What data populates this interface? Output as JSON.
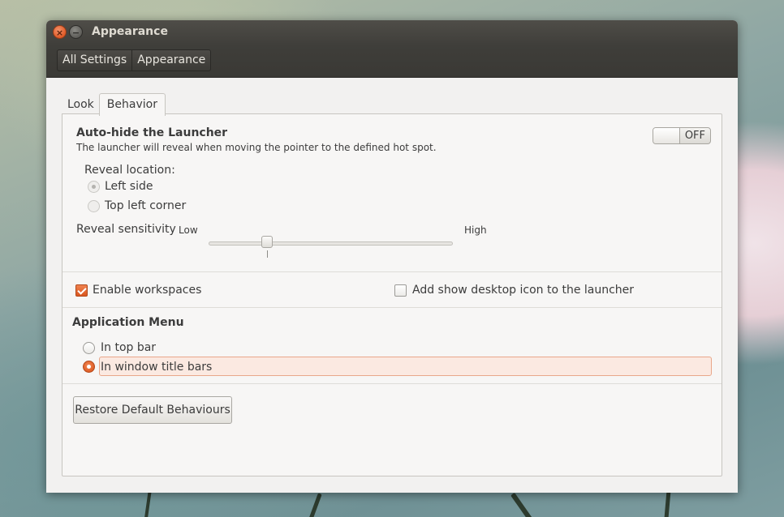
{
  "window": {
    "title": "Appearance",
    "close_symbol": "×",
    "minimize_symbol": "−"
  },
  "breadcrumb": [
    "All Settings",
    "Appearance"
  ],
  "tabs": [
    {
      "label": "Look",
      "active": false
    },
    {
      "label": "Behavior",
      "active": true
    }
  ],
  "launcher": {
    "title": "Auto-hide the Launcher",
    "description": "The launcher will reveal when moving the pointer to the defined hot spot.",
    "toggle_label": "OFF",
    "toggle_on": false,
    "reveal_location_label": "Reveal location:",
    "reveal_options": [
      {
        "label": "Left side",
        "selected": true
      },
      {
        "label": "Top left corner",
        "selected": false
      }
    ],
    "sensitivity_label": "Reveal sensitivity",
    "sensitivity_low": "Low",
    "sensitivity_high": "High",
    "sensitivity_value": 0.24
  },
  "workspaces": {
    "enable_label": "Enable workspaces",
    "enable_checked": true,
    "desktop_icon_label": "Add show desktop icon to the launcher",
    "desktop_icon_checked": false
  },
  "app_menu": {
    "title": "Application Menu",
    "options": [
      {
        "label": "In top bar",
        "selected": false
      },
      {
        "label": "In window title bars",
        "selected": true
      }
    ]
  },
  "restore_button": "Restore Default Behaviours",
  "colors": {
    "accent": "#dd5a22",
    "titlebar": "#3f3e3a",
    "window_bg": "#f2f1f0"
  }
}
